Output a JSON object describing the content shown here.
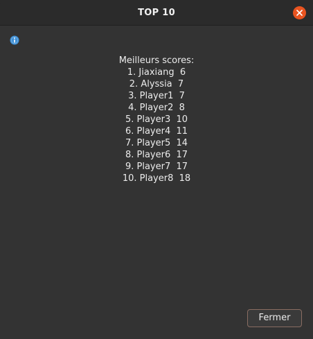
{
  "window": {
    "title": "TOP 10"
  },
  "icons": {
    "close": "close-icon",
    "info": "info-icon"
  },
  "colors": {
    "accent": "#e95420",
    "info": "#3d8fd6"
  },
  "scores": {
    "heading": "Meilleurs scores:",
    "entries": [
      {
        "rank": "1.",
        "name": "Jiaxiang",
        "score": "6"
      },
      {
        "rank": "2.",
        "name": "Alyssia",
        "score": "7"
      },
      {
        "rank": "3.",
        "name": "Player1",
        "score": "7"
      },
      {
        "rank": "4.",
        "name": "Player2",
        "score": "8"
      },
      {
        "rank": "5.",
        "name": "Player3",
        "score": "10"
      },
      {
        "rank": "6.",
        "name": "Player4",
        "score": "11"
      },
      {
        "rank": "7.",
        "name": "Player5",
        "score": "14"
      },
      {
        "rank": "8.",
        "name": "Player6",
        "score": "17"
      },
      {
        "rank": "9.",
        "name": "Player7",
        "score": "17"
      },
      {
        "rank": "10.",
        "name": "Player8",
        "score": "18"
      }
    ]
  },
  "actions": {
    "close_label": "Fermer"
  }
}
